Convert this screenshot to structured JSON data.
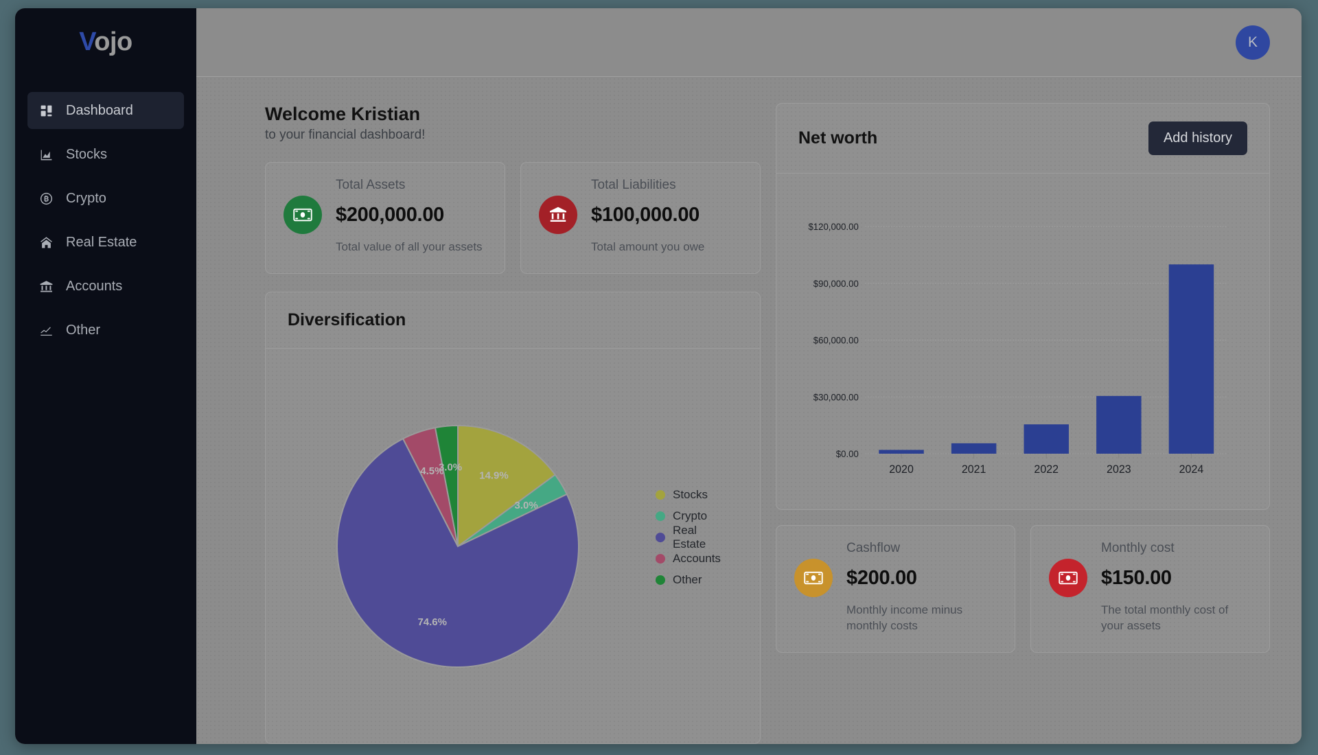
{
  "brand": {
    "accent_letter": "V",
    "rest": "ojo",
    "accent_color": "#2e4aa8"
  },
  "sidebar": {
    "items": [
      {
        "label": "Dashboard",
        "icon": "grid-icon",
        "active": true
      },
      {
        "label": "Stocks",
        "icon": "area-chart-icon",
        "active": false
      },
      {
        "label": "Crypto",
        "icon": "bitcoin-icon",
        "active": false
      },
      {
        "label": "Real Estate",
        "icon": "home-icon",
        "active": false
      },
      {
        "label": "Accounts",
        "icon": "bank-icon",
        "active": false
      },
      {
        "label": "Other",
        "icon": "line-chart-icon",
        "active": false
      }
    ]
  },
  "topbar": {
    "avatar_initial": "K",
    "avatar_color": "#2f47a0"
  },
  "welcome": {
    "heading": "Welcome Kristian",
    "subheading": "to your financial dashboard!"
  },
  "stats": [
    {
      "title": "Total Assets",
      "value": "$200,000.00",
      "subtitle": "Total value of all your assets",
      "icon": "money-icon",
      "icon_color": "#1f7a3d"
    },
    {
      "title": "Total Liabilities",
      "value": "$100,000.00",
      "subtitle": "Total amount you owe",
      "icon": "bank-icon",
      "icon_color": "#a32027"
    }
  ],
  "diversification": {
    "title": "Diversification"
  },
  "networth": {
    "title": "Net worth",
    "add_history_label": "Add history"
  },
  "bottom_stats": [
    {
      "title": "Cashflow",
      "value": "$200.00",
      "subtitle": "Monthly income minus monthly costs",
      "icon": "money-icon",
      "icon_color": "#c8922c"
    },
    {
      "title": "Monthly cost",
      "value": "$150.00",
      "subtitle": "The total monthly cost of your assets",
      "icon": "money-icon",
      "icon_color": "#c4232c"
    }
  ],
  "chart_data": [
    {
      "type": "pie",
      "title": "Diversification",
      "legend_position": "right",
      "start_angle": 0,
      "direction": "clockwise",
      "categories": [
        "Stocks",
        "Crypto",
        "Real Estate",
        "Accounts",
        "Other"
      ],
      "values": [
        14.9,
        3.0,
        74.6,
        4.5,
        3.0
      ],
      "labels": [
        "14.9%",
        "3.0%",
        "74.6%",
        "4.5%",
        "3.0%"
      ],
      "colors": [
        "#a3a33e",
        "#45a884",
        "#4f4b96",
        "#a34a68",
        "#1f8437"
      ],
      "label_color": "#b4b4b4"
    },
    {
      "type": "bar",
      "title": "Net worth",
      "categories": [
        "2020",
        "2021",
        "2022",
        "2023",
        "2024"
      ],
      "values": [
        2000,
        5500,
        15500,
        30500,
        100000
      ],
      "ytick_labels": [
        "$0.00",
        "$30,000.00",
        "$60,000.00",
        "$90,000.00",
        "$120,000.00"
      ],
      "yticks": [
        0,
        30000,
        60000,
        90000,
        120000
      ],
      "ylim": [
        0,
        132000
      ],
      "xlabel": "",
      "ylabel": "",
      "grid": true,
      "bar_color": "#2b3f92"
    }
  ]
}
